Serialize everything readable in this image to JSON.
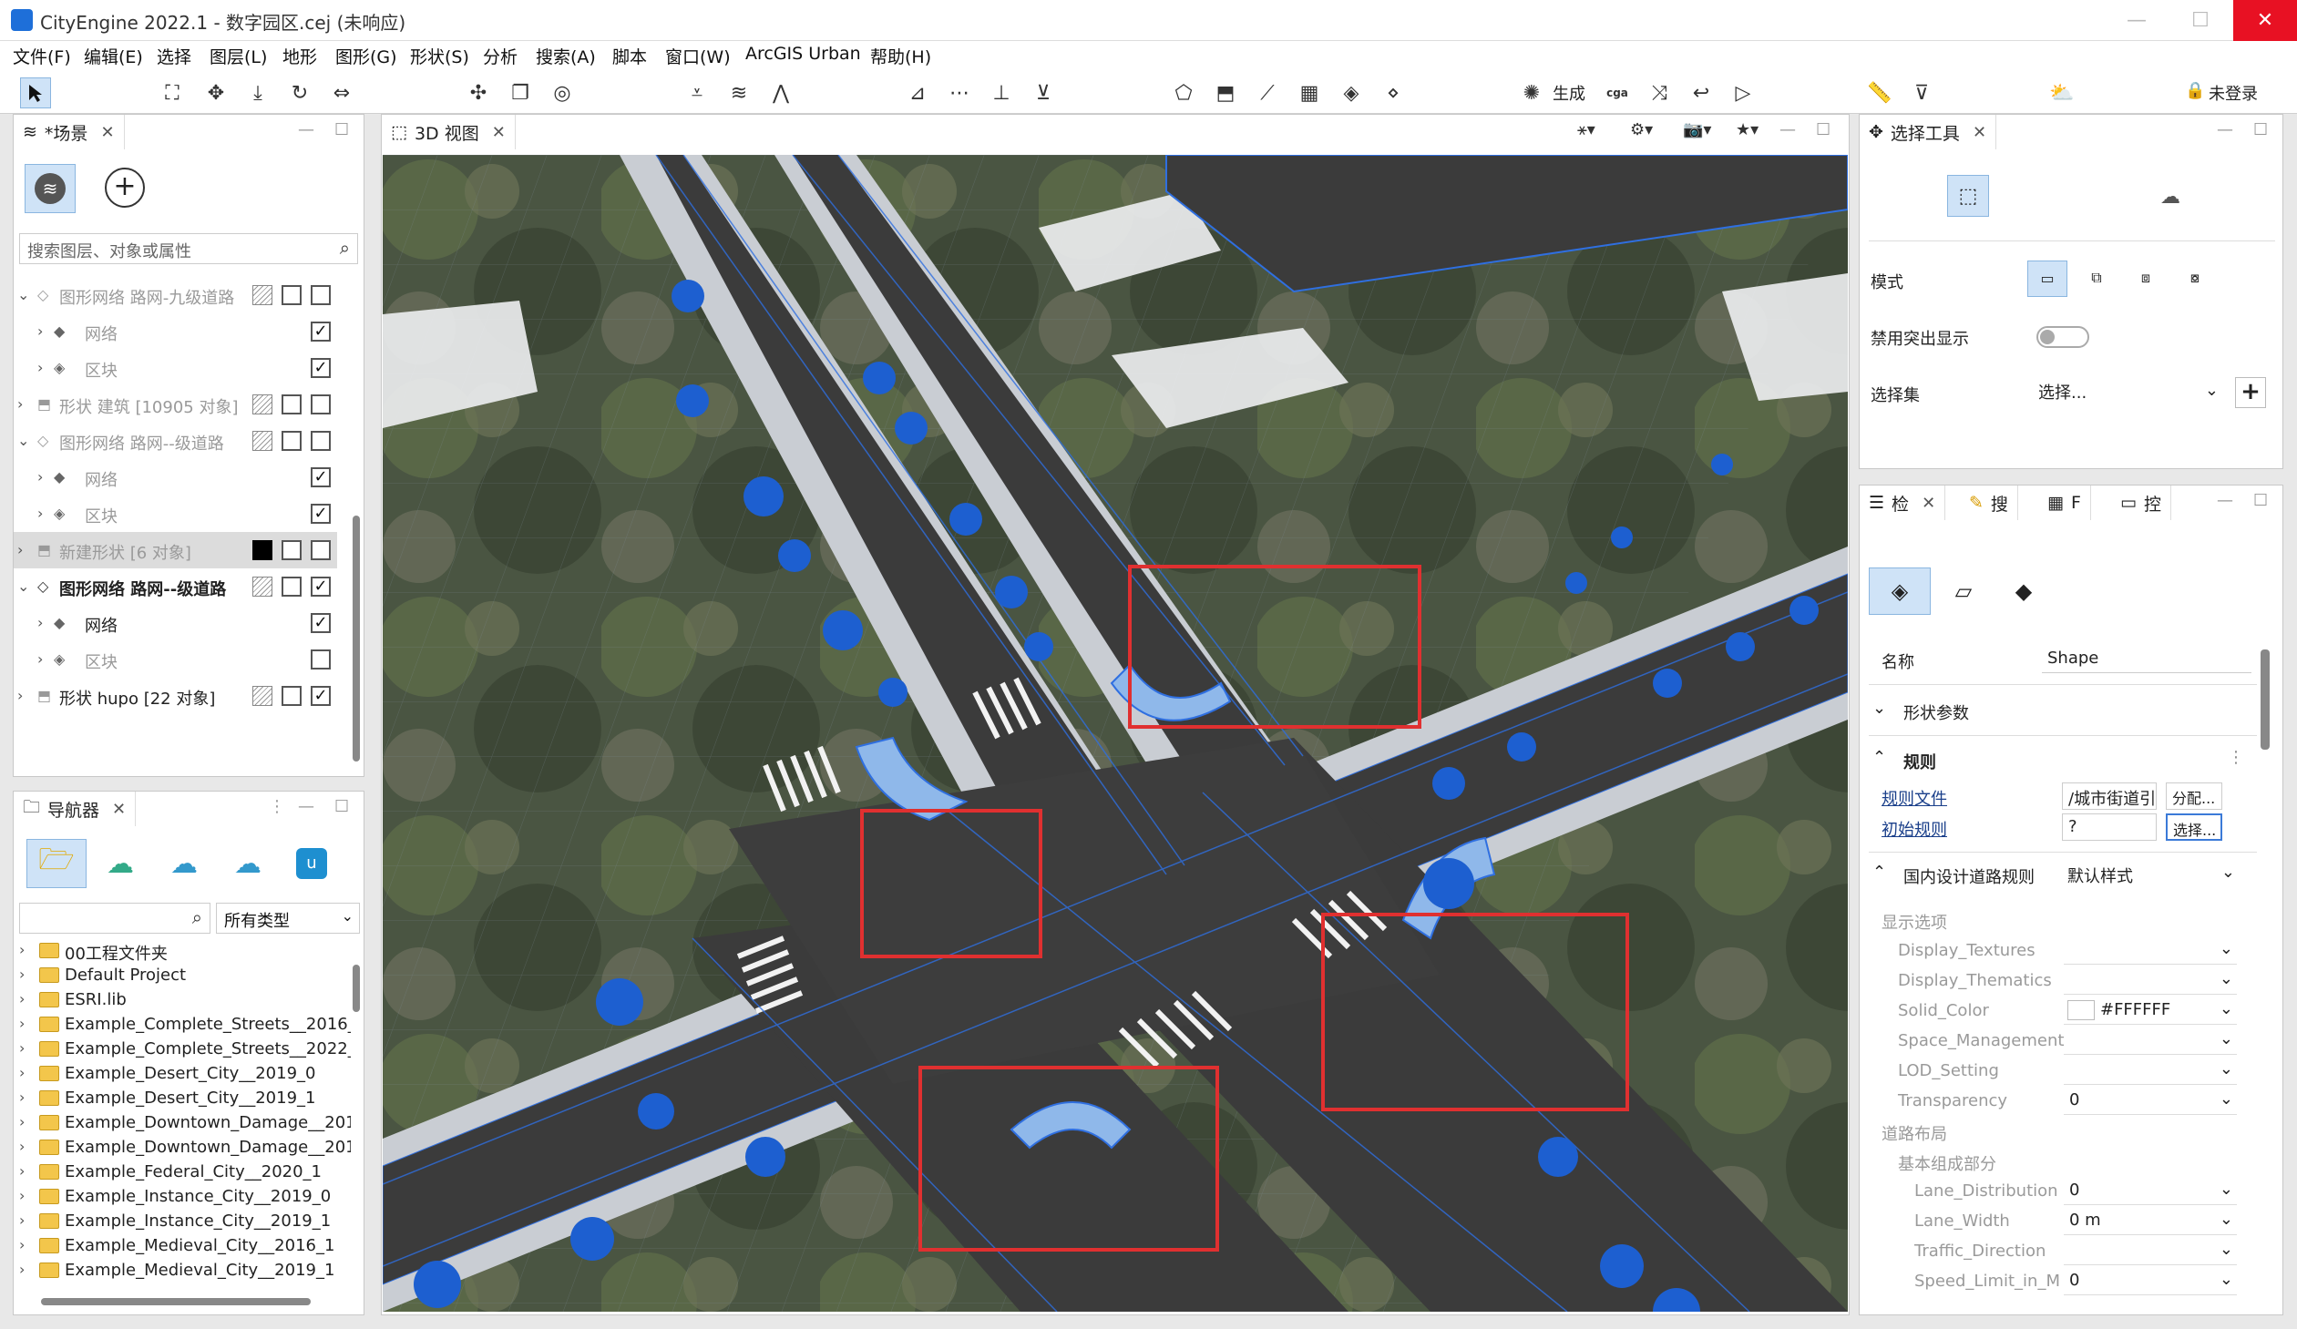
{
  "window": {
    "title": "CityEngine 2022.1 - 数字园区.cej (未响应)",
    "minimize": "—",
    "maximize": "☐",
    "close": "✕"
  },
  "menu": [
    "文件(F)",
    "编辑(E)",
    "选择",
    "图层(L)",
    "地形",
    "图形(G)",
    "形状(S)",
    "分析",
    "搜索(A)",
    "脚本",
    "窗口(W)",
    "ArcGIS Urban",
    "帮助(H)"
  ],
  "toolbar": {
    "generate_label": "生成",
    "cga_label": "cga",
    "login_label": "未登录"
  },
  "scene": {
    "tab_label": "*场景",
    "search_placeholder": "搜索图层、对象或属性",
    "rows": [
      {
        "label": "图形网络 路网-九级道路"
      },
      {
        "label": "网络"
      },
      {
        "label": "区块"
      },
      {
        "label": "形状 建筑 [10905 对象]"
      },
      {
        "label": "图形网络 路网--级道路"
      },
      {
        "label": "网络"
      },
      {
        "label": "区块"
      },
      {
        "label": "新建形状 [6 对象]"
      },
      {
        "label": "图形网络 路网--级道路"
      },
      {
        "label": "网络"
      },
      {
        "label": "区块"
      },
      {
        "label": "形状 hupo [22 对象]"
      }
    ]
  },
  "navigator": {
    "tab_label": "导航器",
    "type_filter": "所有类型",
    "items": [
      "00工程文件夹",
      "Default Project",
      "ESRI.lib",
      "Example_Complete_Streets__2016_",
      "Example_Complete_Streets__2022_",
      "Example_Desert_City__2019_0",
      "Example_Desert_City__2019_1",
      "Example_Downtown_Damage__201",
      "Example_Downtown_Damage__201",
      "Example_Federal_City__2020_1",
      "Example_Instance_City__2019_0",
      "Example_Instance_City__2019_1",
      "Example_Medieval_City__2016_1",
      "Example_Medieval_City__2019_1"
    ]
  },
  "viewport": {
    "tab_label": "3D 视图"
  },
  "selection_tool": {
    "tab_label": "选择工具",
    "mode_label": "模式",
    "disable_highlight_label": "禁用突出显示",
    "selection_set_label": "选择集",
    "selection_set_value": "选择...",
    "add_label": "+"
  },
  "inspector": {
    "tabs": [
      "检",
      "搜",
      "F",
      "控"
    ],
    "name_label": "名称",
    "name_value": "Shape",
    "shape_params_label": "形状参数",
    "rules_label": "规则",
    "rule_file_label": "规则文件",
    "rule_file_value": "/城市街道引",
    "assign_button": "分配...",
    "start_rule_label": "初始规则",
    "start_rule_value": "?",
    "select_button": "选择...",
    "rule_group_label": "国内设计道路规则",
    "rule_style_value": "默认样式",
    "display_options_label": "显示选项",
    "attrs": [
      {
        "name": "Display_Textures",
        "value": ""
      },
      {
        "name": "Display_Thematics",
        "value": ""
      },
      {
        "name": "Solid_Color",
        "value": "#FFFFFF"
      },
      {
        "name": "Space_Management",
        "value": ""
      },
      {
        "name": "LOD_Setting",
        "value": ""
      },
      {
        "name": "Transparency",
        "value": "0"
      }
    ],
    "road_layout_label": "道路布局",
    "basic_parts_label": "基本组成部分",
    "lane_attrs": [
      {
        "name": "Lane_Distribution",
        "value": "0"
      },
      {
        "name": "Lane_Width",
        "value": "0 m"
      },
      {
        "name": "Traffic_Direction",
        "value": ""
      },
      {
        "name": "Speed_Limit_in_M",
        "value": "0"
      }
    ]
  },
  "colors": {
    "accent": "#1e6fd9",
    "highlight_box": "#e03030",
    "road": "#3b3b3b",
    "sidewalk": "#c9cdd3",
    "wire_blue": "#2f6fe0"
  }
}
